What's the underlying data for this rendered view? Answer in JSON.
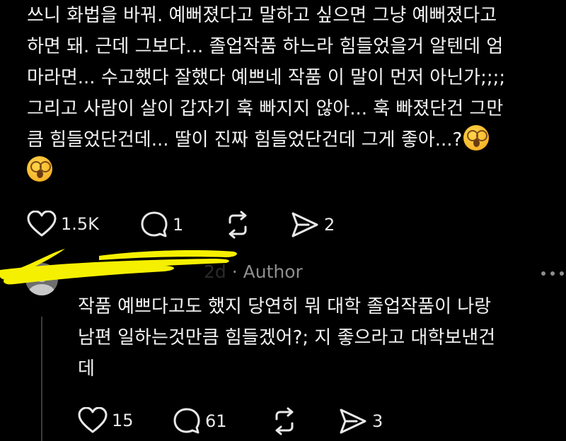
{
  "post": {
    "lines": [
      "쓰니 화법을 바꿔. 예뻐졌다고 말하고 싶으면 그냥 예뻐졌다고",
      "하면 돼. 근데 그보다... 졸업작품 하느라 힘들었을거 알텐데 엄",
      "마라면... 수고했다 잘했다 예쁘네 작품 이 말이 먼저 아닌가;;;;",
      "그리고 사람이 살이 갑자기 훅 빠지지 않아... 훅 빠졌단건 그만",
      "큼 힘들었단건데... 딸이 진짜 힘들었단건데 그게 좋아...?"
    ],
    "emoji_names": [
      "astonished-face-emoji",
      "astonished-face-emoji"
    ],
    "actions": {
      "likes": "1.5K",
      "comments": "1",
      "reposts": "",
      "shares": "2"
    }
  },
  "reply": {
    "meta": "· Author",
    "lines": [
      "작품 예쁘다고도 했지 당연히 뭐 대학 졸업작품이 나랑",
      "남편 일하는것만큼 힘들겠어?; 지 좋으라고 대학보낸건",
      "데"
    ],
    "actions": {
      "likes": "15",
      "comments": "61",
      "reposts": "",
      "shares": "3"
    }
  },
  "colors": {
    "background": "#000000",
    "text": "#f3f3f3",
    "muted": "#8e8e8e",
    "highlight": "#f5f000"
  }
}
